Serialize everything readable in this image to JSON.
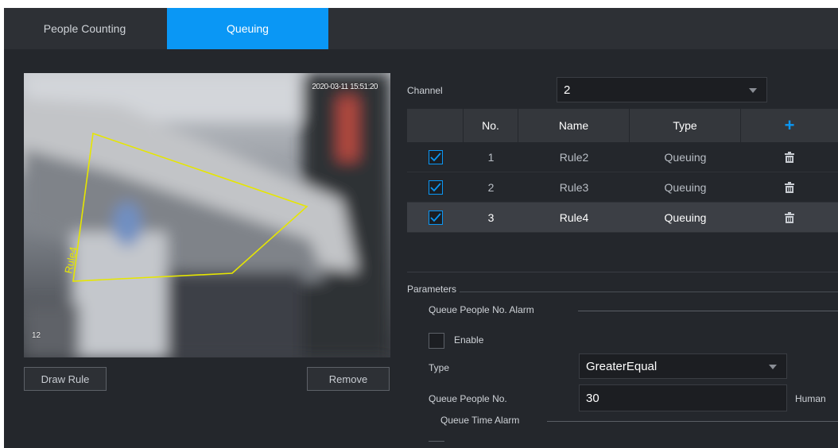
{
  "tabs": [
    {
      "label": "People Counting",
      "active": false
    },
    {
      "label": "Queuing",
      "active": true
    }
  ],
  "preview": {
    "timestamp": "2020-03-11 15:51:20",
    "channel_number": "12",
    "rule_label": "Rule4",
    "rule_color": "#e6e600"
  },
  "buttons": {
    "draw_rule": "Draw Rule",
    "remove": "Remove"
  },
  "channel": {
    "label": "Channel",
    "value": "2"
  },
  "rules_table": {
    "headers": [
      "No.",
      "Name",
      "Type"
    ],
    "rows": [
      {
        "no": "1",
        "name": "Rule2",
        "type": "Queuing",
        "checked": true,
        "selected": false
      },
      {
        "no": "2",
        "name": "Rule3",
        "type": "Queuing",
        "checked": true,
        "selected": false
      },
      {
        "no": "3",
        "name": "Rule4",
        "type": "Queuing",
        "checked": true,
        "selected": true
      }
    ]
  },
  "parameters": {
    "title": "Parameters",
    "queue_people_alarm": {
      "title": "Queue People No. Alarm",
      "enable_label": "Enable",
      "enabled": false,
      "type_label": "Type",
      "type_value": "GreaterEqual",
      "people_label": "Queue People No.",
      "people_value": "30",
      "people_unit": "Human"
    },
    "queue_time_alarm": {
      "title": "Queue Time Alarm"
    }
  },
  "colors": {
    "accent": "#0a97f5",
    "background": "#24272c",
    "panel": "#2d3035"
  }
}
